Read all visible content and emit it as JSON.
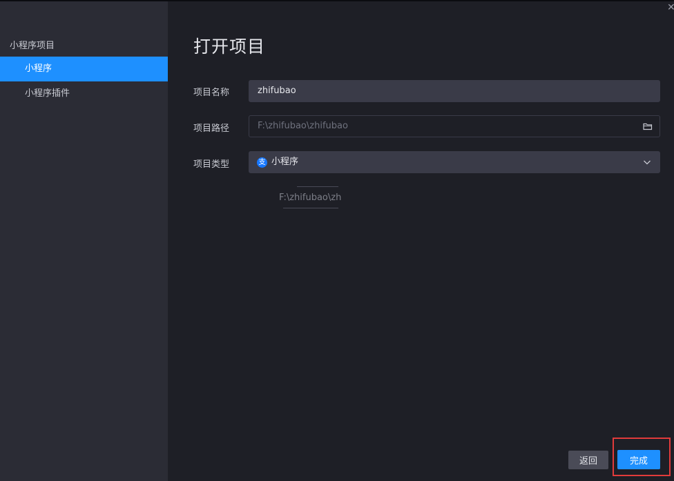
{
  "sidebar": {
    "group_title": "小程序项目",
    "items": [
      {
        "label": "小程序",
        "active": true
      },
      {
        "label": "小程序插件",
        "active": false
      }
    ]
  },
  "main": {
    "title": "打开项目",
    "fields": {
      "name": {
        "label": "项目名称",
        "value": "zhifubao"
      },
      "path": {
        "label": "项目路径",
        "value": "F:\\zhifubao\\zhifubao",
        "icon": "folder-icon"
      },
      "type": {
        "label": "项目类型",
        "value": "小程序",
        "icon": "alipay-icon",
        "glyph": "支"
      }
    },
    "ghost_text": "F:\\zhifubao\\zh"
  },
  "footer": {
    "back_label": "返回",
    "done_label": "完成"
  },
  "colors": {
    "accent": "#1e90ff",
    "sidebar_bg": "#2b2c35",
    "main_bg": "#1e1f26",
    "highlight": "#e23b3b"
  }
}
